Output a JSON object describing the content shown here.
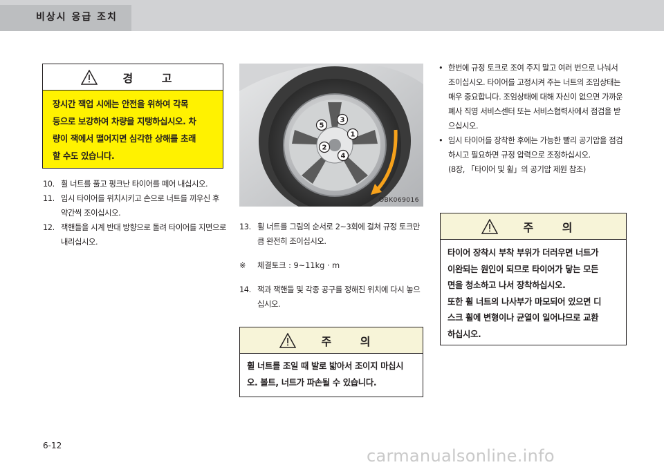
{
  "header": {
    "title": "비상시 응급 조치"
  },
  "warning": {
    "title": "경 고",
    "lines": [
      "장시간 잭업 시에는 안전을 위하여 각목",
      "등으로 보강하여 차량을 지탱하십시오. 차",
      "량이 잭에서 떨어지면 심각한 상해를 초래",
      "할 수도 있습니다."
    ]
  },
  "left_steps": [
    {
      "num": "10.",
      "text": "휠 너트를 풀고 펑크난 타이어를 떼어 내십시오."
    },
    {
      "num": "11.",
      "text": "임시 타이어를 위치시키고 손으로 너트를 끼우신 후 약간씩 조이십시오."
    },
    {
      "num": "12.",
      "text": "잭핸들을 시계 반대 방향으로 돌려 타이어를 지면으로 내리십시오."
    }
  ],
  "figure": {
    "code": "OBK069016",
    "nut_labels": [
      "1",
      "2",
      "3",
      "4",
      "5"
    ]
  },
  "mid_steps": {
    "step13": {
      "num": "13.",
      "text": "휠 너트를 그림의 순서로 2~3회에 걸쳐 규정 토크만큼 완전히 조이십시오."
    },
    "note": {
      "mark": "※",
      "text": "체결토크 : 9~11kg · m"
    },
    "step14": {
      "num": "14.",
      "text": "잭과 잭핸들 및 각종 공구를 정해진 위치에 다시 놓으십시오."
    }
  },
  "caution1": {
    "title": "주 의",
    "lines": [
      "휠 너트를 조일 때 발로 밟아서 조이지 마십시",
      "오. 볼트, 너트가 파손될 수 있습니다."
    ]
  },
  "right_bullets": [
    {
      "dot": "•",
      "text": "한번에 규정 토크로 조여 주지 말고 여러 번으로 나눠서 조이십시오. 타이어를 고정시켜 주는 너트의 조임상태는 매우 중요합니다. 조임상태에 대해 자신이 없으면 가까운 폐사 직영 서비스센터 또는 서비스협력사에서 점검을 받으십시오."
    },
    {
      "dot": "•",
      "text": "임시 타이어를 장착한 후에는 가능한 빨리 공기압을 점검하시고 필요하면 규정 압력으로 조정하십시오."
    }
  ],
  "right_ref": "(8장, 「타이어 및 휠」의 공기압 제원 참조)",
  "caution2": {
    "title": "주 의",
    "lines": [
      "타이어 장착시 부착 부위가 더러우면 너트가",
      "이완되는 원인이 되므로 타이어가 닿는 모든",
      "면을 청소하고 나서 장착하십시오.",
      "또한 휠 너트의 나사부가 마모되어 있으면 디",
      "스크 휠에 변형이나 균열이 일어나므로 교환",
      "하십시오."
    ]
  },
  "footer": {
    "page": "6-12",
    "watermark": "carmanualsonline.info"
  }
}
